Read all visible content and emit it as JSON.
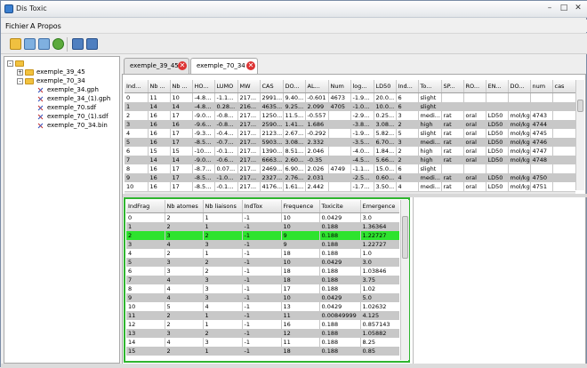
{
  "window": {
    "title": "Dis Toxic",
    "minimize": "–",
    "maximize": "□",
    "close": "✕"
  },
  "menu": {
    "items": [
      "Fichier",
      "A Propos"
    ]
  },
  "toolbar": {
    "icons": [
      "open-folder-icon",
      "import-icon",
      "export-icon",
      "refresh-icon",
      "save-icon",
      "save-as-icon"
    ]
  },
  "tree": {
    "root": "",
    "nodes": [
      {
        "label": "exemple_39_45",
        "type": "folder"
      },
      {
        "label": "exemple_70_34",
        "type": "folder"
      },
      {
        "label": "exemple_34.gph",
        "type": "file"
      },
      {
        "label": "exemple_34_(1).gph",
        "type": "file"
      },
      {
        "label": "exemple_70.sdf",
        "type": "file"
      },
      {
        "label": "exemple_70_(1).sdf",
        "type": "file"
      },
      {
        "label": "exemple_70_34.bin",
        "type": "file"
      }
    ]
  },
  "tabs": [
    {
      "label": "exemple_39_45"
    },
    {
      "label": "exemple_70_34"
    }
  ],
  "top_table": {
    "columns": [
      "Ind...",
      "Nb ...",
      "Nb ...",
      "HO...",
      "LUMO",
      "MW",
      "CAS",
      "DO...",
      "AL...",
      "Num",
      "log...",
      "LD50",
      "Ind...",
      "To...",
      "SP...",
      "RO...",
      "EN...",
      "DO...",
      "num",
      "cas"
    ],
    "rows": [
      [
        "0",
        "11",
        "10",
        "-4.8...",
        "-1.1...",
        "217...",
        "2991...",
        "9.40...",
        "-0.601",
        "4673",
        "-1.9...",
        "20.0...",
        "6",
        "slight",
        "",
        "",
        "",
        "",
        "",
        ""
      ],
      [
        "1",
        "14",
        "14",
        "-4.8...",
        "0.28...",
        "216...",
        "4635...",
        "9.25...",
        "2.099",
        "4705",
        "-1.0...",
        "10.0...",
        "6",
        "slight",
        "",
        "",
        "",
        "",
        "",
        ""
      ],
      [
        "2",
        "16",
        "17",
        "-9.0...",
        "-0.8...",
        "217...",
        "1250...",
        "11.5...",
        "-0.557",
        "",
        "-2.9...",
        "0.25...",
        "3",
        "medi...",
        "rat",
        "oral",
        "LD50",
        "mol/kg",
        "4743",
        ""
      ],
      [
        "3",
        "16",
        "16",
        "-9.6...",
        "-0.8...",
        "217...",
        "2590...",
        "1.41...",
        "1.686",
        "",
        "-3.8...",
        "3.08...",
        "2",
        "high",
        "rat",
        "oral",
        "LD50",
        "mol/kg",
        "4744",
        ""
      ],
      [
        "4",
        "16",
        "17",
        "-9.3...",
        "-0.4...",
        "217...",
        "2123...",
        "2.67...",
        "-0.292",
        "",
        "-1.9...",
        "5.82...",
        "5",
        "slight",
        "rat",
        "oral",
        "LD50",
        "mol/kg",
        "4745",
        ""
      ],
      [
        "5",
        "16",
        "17",
        "-8.5...",
        "-0.7...",
        "217...",
        "5903...",
        "3.08...",
        "2.332",
        "",
        "-3.5...",
        "6.70...",
        "3",
        "medi...",
        "rat",
        "oral",
        "LD50",
        "mol/kg",
        "4746",
        ""
      ],
      [
        "6",
        "15",
        "15",
        "-10....",
        "-0.1...",
        "217...",
        "1390...",
        "8.51...",
        "2.046",
        "",
        "-4.0...",
        "1.84...",
        "2",
        "high",
        "rat",
        "oral",
        "LD50",
        "mol/kg",
        "4747",
        ""
      ],
      [
        "7",
        "14",
        "14",
        "-9.0...",
        "-0.6...",
        "217...",
        "6663...",
        "2.60...",
        "-0.35",
        "",
        "-4.5...",
        "5.66...",
        "2",
        "high",
        "rat",
        "oral",
        "LD50",
        "mol/kg",
        "4748",
        ""
      ],
      [
        "8",
        "16",
        "17",
        "-8.7...",
        "0.07...",
        "217...",
        "2469...",
        "6.90...",
        "2.026",
        "4749",
        "-1.1...",
        "15.0...",
        "6",
        "slight",
        "",
        "",
        "",
        "",
        "",
        ""
      ],
      [
        "9",
        "16",
        "17",
        "-8.5...",
        "-1.0...",
        "217...",
        "2327...",
        "2.76...",
        "2.031",
        "",
        "-2.5...",
        "0.60...",
        "4",
        "medi...",
        "rat",
        "oral",
        "LD50",
        "mol/kg",
        "4750",
        ""
      ],
      [
        "10",
        "16",
        "17",
        "-8.5...",
        "-0.1...",
        "217...",
        "4176...",
        "1.61...",
        "2.442",
        "",
        "-1.7...",
        "3.50...",
        "4",
        "medi...",
        "rat",
        "oral",
        "LD50",
        "mol/kg",
        "4751",
        ""
      ]
    ]
  },
  "bottom_table": {
    "columns": [
      "IndFrag",
      "Nb atomes",
      "Nb liaisons",
      "IndTox",
      "Frequence",
      "Toxicite",
      "Emergence"
    ],
    "highlighted_row": 2,
    "rows": [
      [
        "0",
        "2",
        "1",
        "-1",
        "10",
        "0.0429",
        "3.0"
      ],
      [
        "1",
        "2",
        "1",
        "-1",
        "10",
        "0.188",
        "1.36364"
      ],
      [
        "2",
        "3",
        "2",
        "-1",
        "9",
        "0.188",
        "1.22727"
      ],
      [
        "3",
        "4",
        "3",
        "-1",
        "9",
        "0.188",
        "1.22727"
      ],
      [
        "4",
        "2",
        "1",
        "-1",
        "18",
        "0.188",
        "1.0"
      ],
      [
        "5",
        "3",
        "2",
        "-1",
        "10",
        "0.0429",
        "3.0"
      ],
      [
        "6",
        "3",
        "2",
        "-1",
        "18",
        "0.188",
        "1.03846"
      ],
      [
        "7",
        "4",
        "3",
        "-1",
        "18",
        "0.188",
        "3.75"
      ],
      [
        "8",
        "4",
        "3",
        "-1",
        "17",
        "0.188",
        "1.02"
      ],
      [
        "9",
        "4",
        "3",
        "-1",
        "10",
        "0.0429",
        "5.0"
      ],
      [
        "10",
        "5",
        "4",
        "-1",
        "13",
        "0.0429",
        "1.02632"
      ],
      [
        "11",
        "2",
        "1",
        "-1",
        "11",
        "0.00849999",
        "4.125"
      ],
      [
        "12",
        "2",
        "1",
        "-1",
        "16",
        "0.188",
        "0.857143"
      ],
      [
        "13",
        "3",
        "2",
        "-1",
        "12",
        "0.188",
        "1.05882"
      ],
      [
        "14",
        "4",
        "3",
        "-1",
        "11",
        "0.188",
        "8.25"
      ],
      [
        "15",
        "2",
        "1",
        "-1",
        "18",
        "0.188",
        "0.85"
      ]
    ]
  }
}
